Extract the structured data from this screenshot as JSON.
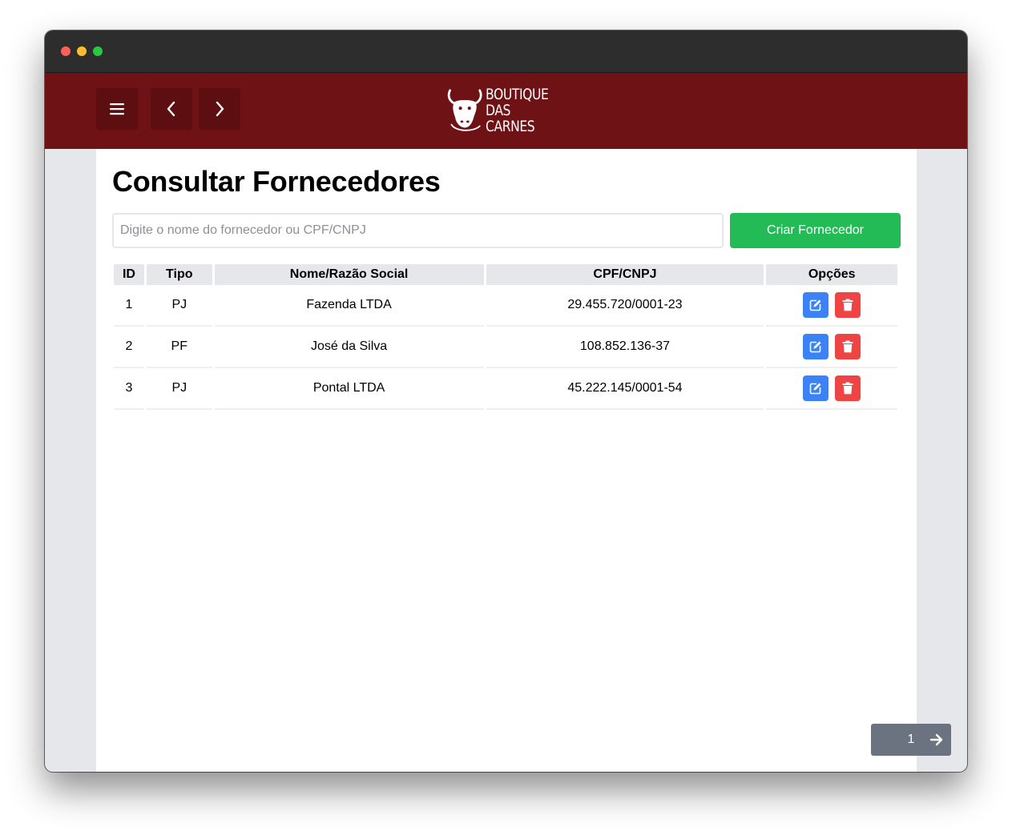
{
  "brand": {
    "line1": "BOUTIQUE",
    "line2": "DAS CARNES",
    "header_color": "#6f1215"
  },
  "nav": {
    "menu_icon": "hamburger-icon",
    "back_icon": "chevron-left-icon",
    "forward_icon": "chevron-right-icon"
  },
  "page": {
    "title": "Consultar Fornecedores"
  },
  "search": {
    "placeholder": "Digite o nome do fornecedor ou CPF/CNPJ",
    "value": ""
  },
  "actions": {
    "create_label": "Criar Fornecedor",
    "create_color": "#22bb55"
  },
  "table": {
    "headers": {
      "id": "ID",
      "tipo": "Tipo",
      "nome": "Nome/Razão Social",
      "cpf": "CPF/CNPJ",
      "opcoes": "Opções"
    },
    "rows": [
      {
        "id": "1",
        "tipo": "PJ",
        "nome": "Fazenda LTDA",
        "cpf": "29.455.720/0001-23"
      },
      {
        "id": "2",
        "tipo": "PF",
        "nome": "José da Silva",
        "cpf": "108.852.136-37"
      },
      {
        "id": "3",
        "tipo": "PJ",
        "nome": "Pontal LTDA",
        "cpf": "45.222.145/0001-54"
      }
    ],
    "edit_icon": "edit-icon",
    "delete_icon": "trash-icon",
    "edit_color": "#3b82f6",
    "delete_color": "#ef4444"
  },
  "pagination": {
    "current_page": "1",
    "next_icon": "arrow-right-icon"
  }
}
